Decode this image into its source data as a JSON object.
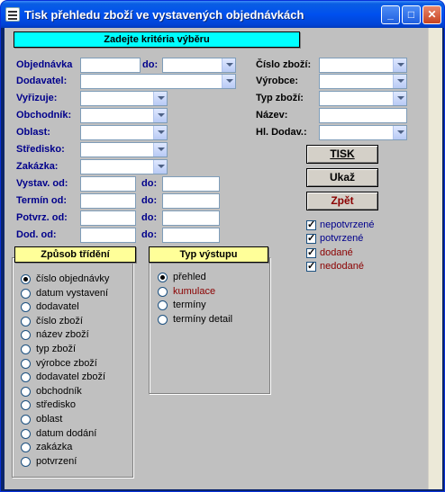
{
  "window": {
    "title": "Tisk přehledu zboží ve vystavených objednávkách"
  },
  "header": {
    "criteria_label": "Zadejte kritéria výběru"
  },
  "fields": {
    "objednavka": "Objednávka",
    "do": "do:",
    "dodavatel": "Dodavatel:",
    "vyrizuje": "Vyřizuje:",
    "obchodnik": "Obchodník:",
    "oblast": "Oblast:",
    "stredisko": "Středisko:",
    "zakazka": "Zakázka:",
    "vystav_od": "Vystav. od:",
    "termin_od": "Termín od:",
    "potvrz_od": "Potvrz. od:",
    "dod_od": "Dod. od:",
    "cislo_zbozi": "Číslo zboží:",
    "vyrobce": "Výrobce:",
    "typ_zbozi": "Typ zboží:",
    "nazev": "Název:",
    "hl_dodav": "Hl. Dodav.:"
  },
  "buttons": {
    "tisk": "TISK",
    "ukaz": "Ukaž",
    "zpet": "Zpět"
  },
  "filters": [
    {
      "label": "nepotvrzené",
      "checked": true,
      "color": "#00008b"
    },
    {
      "label": "potvrzené",
      "checked": true,
      "color": "#00008b"
    },
    {
      "label": "dodané",
      "checked": true,
      "color": "#8b0000"
    },
    {
      "label": "nedodané",
      "checked": true,
      "color": "#8b0000"
    }
  ],
  "sort": {
    "title": "Způsob třídění",
    "options": [
      {
        "label": "číslo objednávky",
        "selected": true
      },
      {
        "label": "datum vystavení",
        "selected": false
      },
      {
        "label": "dodavatel",
        "selected": false
      },
      {
        "label": "číslo zboží",
        "selected": false
      },
      {
        "label": "název zboží",
        "selected": false
      },
      {
        "label": "typ zboží",
        "selected": false
      },
      {
        "label": "výrobce zboží",
        "selected": false
      },
      {
        "label": "dodavatel zboží",
        "selected": false
      },
      {
        "label": "obchodník",
        "selected": false
      },
      {
        "label": "středisko",
        "selected": false
      },
      {
        "label": "oblast",
        "selected": false
      },
      {
        "label": "datum dodání",
        "selected": false
      },
      {
        "label": "zakázka",
        "selected": false
      },
      {
        "label": "potvrzení",
        "selected": false
      }
    ]
  },
  "output": {
    "title": "Typ výstupu",
    "options": [
      {
        "label": "přehled",
        "selected": true,
        "color": "#000000"
      },
      {
        "label": "kumulace",
        "selected": false,
        "color": "#8b0000"
      },
      {
        "label": "termíny",
        "selected": false,
        "color": "#000000"
      },
      {
        "label": "termíny detail",
        "selected": false,
        "color": "#000000"
      }
    ]
  },
  "colors": {
    "accent": "#00ffff",
    "group_header": "#ffff99",
    "form_bg": "#c0c0c0"
  }
}
